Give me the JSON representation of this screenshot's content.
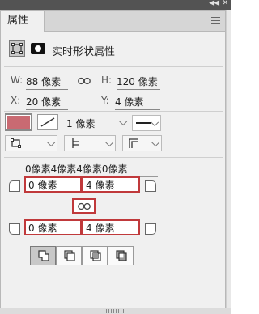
{
  "panel": {
    "tab_label": "属性",
    "header_title": "实时形状属性"
  },
  "transform": {
    "w_label": "W:",
    "w_value": "88 像素",
    "h_label": "H:",
    "h_value": "120 像素",
    "x_label": "X:",
    "x_value": "20 像素",
    "y_label": "Y:",
    "y_value": "4 像素"
  },
  "stroke": {
    "fill_color": "#c96a72",
    "width_value": "1 像素"
  },
  "corners": {
    "summary": "0像素4像素4像素0像素",
    "top_left": "0 像素",
    "top_right": "4 像素",
    "bottom_left": "0 像素",
    "bottom_right": "4 像素"
  },
  "colors": {
    "highlight": "#c0393b",
    "swatch": "#c96a72"
  }
}
